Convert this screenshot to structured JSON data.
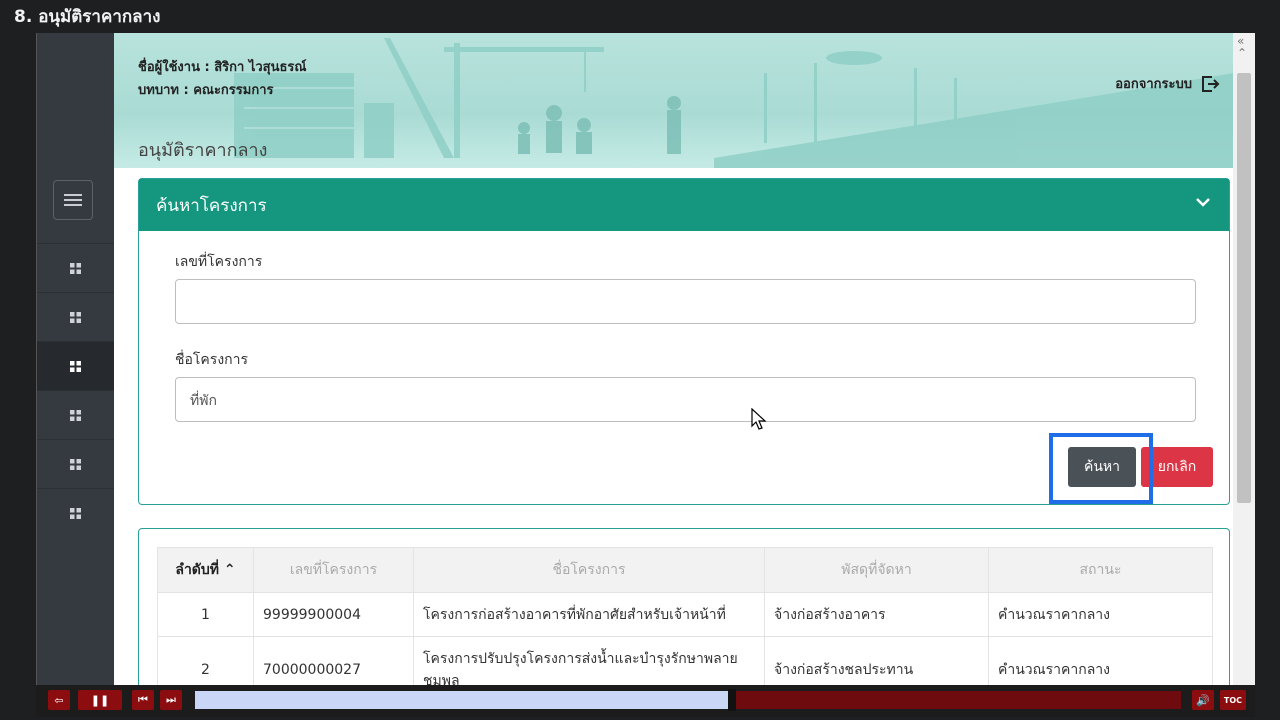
{
  "lesson_title": "8. อนุมัติราคากลาง",
  "user": {
    "name_label": "ชื่อผู้ใช้งาน : สิริกา ไวสุนธรณ์",
    "role_label": "บทบาท : คณะกรรมการ"
  },
  "logout_label": "ออกจากระบบ",
  "page_title": "อนุมัติราคากลาง",
  "search_card": {
    "title": "ค้นหาโครงการ",
    "project_no_label": "เลขที่โครงการ",
    "project_no_value": "",
    "project_name_label": "ชื่อโครงการ",
    "project_name_value": "ที่พัก",
    "search_button": "ค้นหา",
    "cancel_button": "ยกเลิก"
  },
  "table": {
    "headers": [
      "ลำดับที่",
      "เลขที่โครงการ",
      "ชื่อโครงการ",
      "พัสดุที่จัดหา",
      "สถานะ"
    ],
    "rows": [
      [
        "1",
        "99999900004",
        "โครงการก่อสร้างอาคารที่พักอาศัยสำหรับเจ้าหน้าที่",
        "จ้างก่อสร้างอาคาร",
        "คำนวณราคากลาง"
      ],
      [
        "2",
        "70000000027",
        "โครงการปรับปรุงโครงการส่งน้ำและบำรุงรักษาพลายชุมพล",
        "จ้างก่อสร้างชลประทาน",
        "คำนวณราคากลาง"
      ]
    ]
  },
  "sidebar": {
    "active_index": 2
  },
  "player": {
    "progress": 0.545,
    "toc_label": "TOC"
  },
  "colors": {
    "header_green": "#14967f",
    "cancel_red": "#dc3545",
    "search_gray": "#4a5157",
    "highlight_blue": "#1f6ee8"
  }
}
